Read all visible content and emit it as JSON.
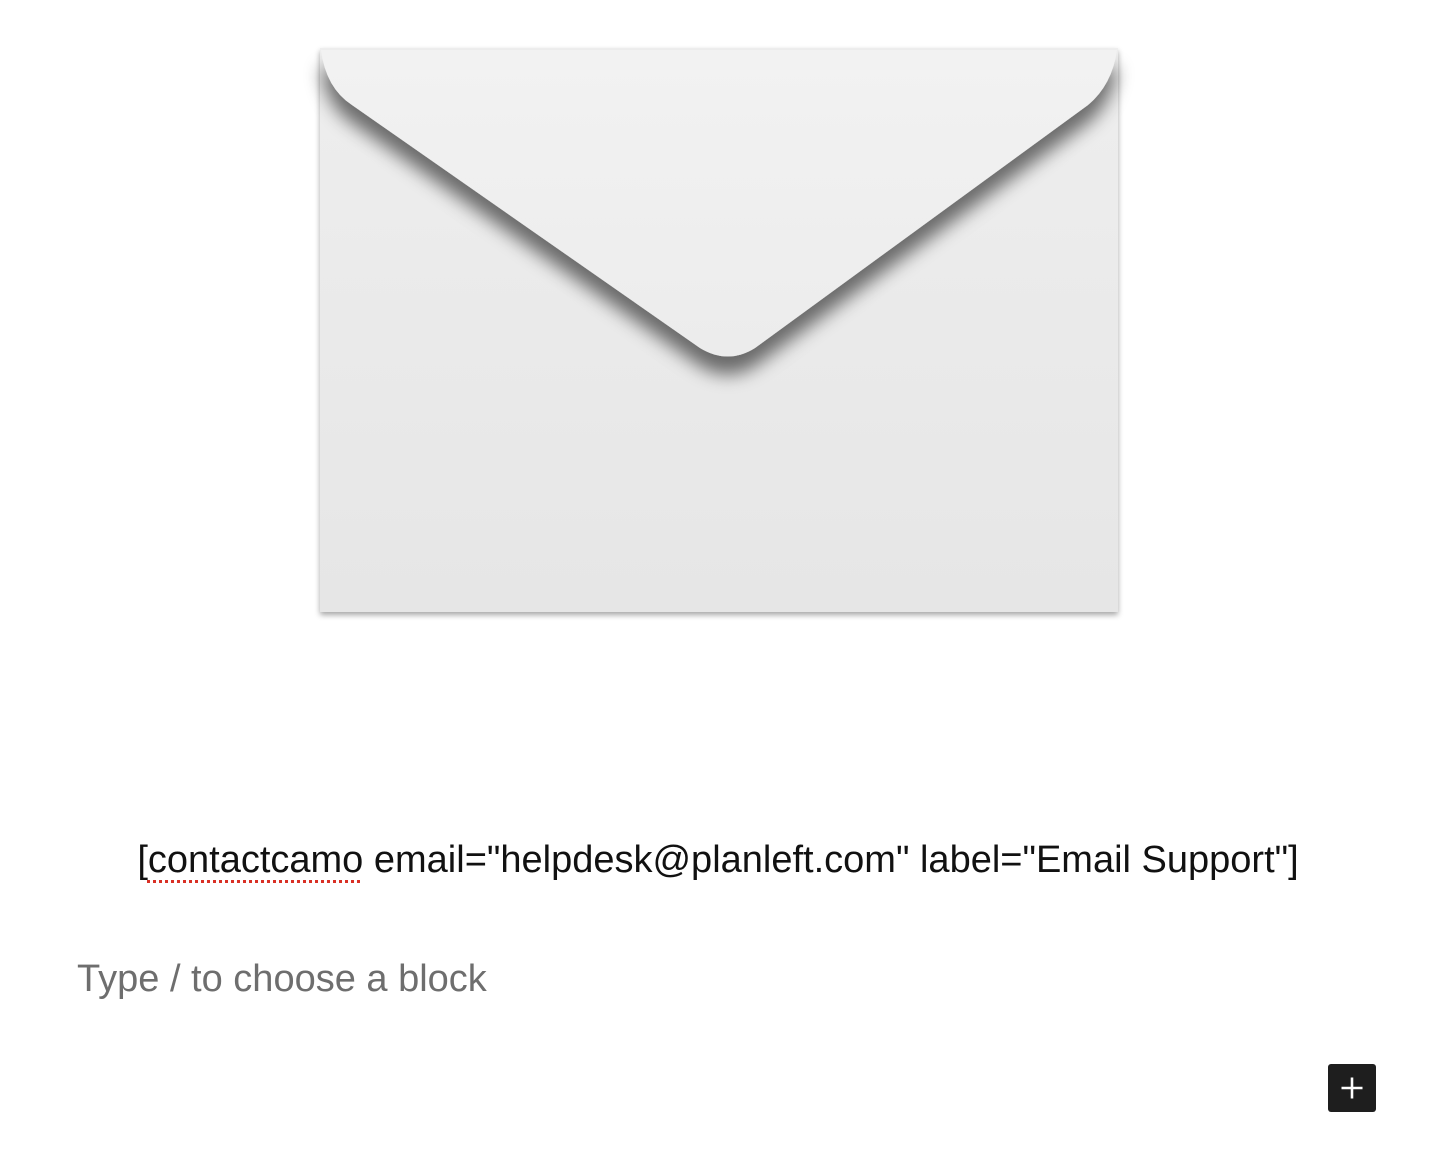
{
  "content": {
    "image": {
      "icon": "envelope-image",
      "alt": ""
    },
    "shortcode": {
      "tag": "contactcamo",
      "rest": " email=\"helpdesk@planleft.com\" label=\"Email Support\"]",
      "open_bracket": "["
    },
    "placeholder": "Type / to choose a block",
    "inserter": {
      "icon": "plus-icon",
      "background": "#1e1e1e"
    }
  },
  "colors": {
    "text": "#111111",
    "placeholder": "#6e6e6e",
    "spellcheck": "#d93025"
  }
}
